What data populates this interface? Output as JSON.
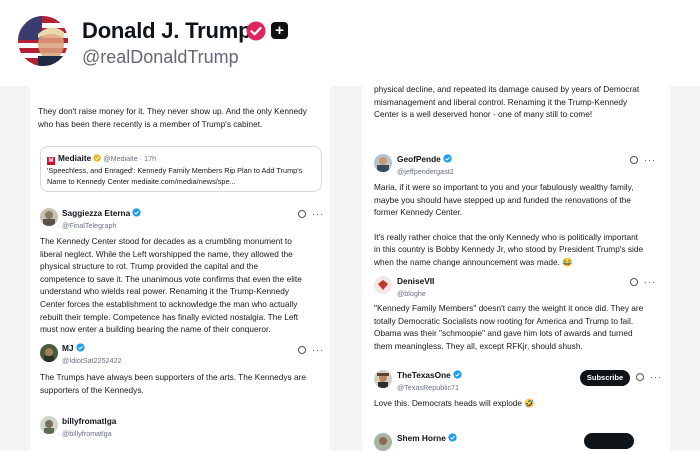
{
  "header": {
    "display_name": "Donald J. Trump",
    "handle": "@realDonaldTrump"
  },
  "left": {
    "top_text_1": "They don't raise money for it. They never show up. And the only Kennedy",
    "top_text_2": "who has been there recently is a member of Trump's cabinet.",
    "quote": {
      "source": "Mediaite",
      "handle_time": "@Mediaite · 17h",
      "line1": "'Speechless, and Enraged': Kennedy Family Members Rip Plan to Add Trump's",
      "line2": "Name to Kennedy Center  mediaite.com/media/news/spe..."
    },
    "tweets": [
      {
        "name": "Saggiezza Eterna",
        "handle": "@FinalTelegraph",
        "lines": [
          "The Kennedy Center stood for decades as a crumbling monument to",
          "liberal neglect. While the Left worshipped the name, they allowed the",
          "physical structure to rot. Trump provided the capital and the",
          "competence to save it. The unanimous vote confirms that even the elite",
          "understand who wields real power. Renaming it the Trump-Kennedy",
          "Center forces the establishment to acknowledge the man who actually",
          "rebuilt their temple. Competence has finally evicted nostalgia. The Left",
          "must now enter a building bearing the name of their conqueror."
        ]
      },
      {
        "name": "MJ",
        "handle": "@IdiotSat2252422",
        "lines": [
          "The Trumps have always been supporters of the arts. The Kennedys are",
          "supporters of the Kennedys."
        ]
      },
      {
        "name": "billyfromatlga",
        "handle": "@billyfromatlga",
        "lines": []
      }
    ]
  },
  "right": {
    "top_text_0": "physical decline, and repeated its damage caused by years of Democrat",
    "top_text_1": "mismanagement and liberal control.  Renaming it the Trump-Kennedy",
    "top_text_2": "Center is a well deserved honor - one of many still to come!",
    "tweets": [
      {
        "name": "GeofPende",
        "handle": "@jeffpendergast2",
        "lines": [
          "Maria, if it were so important to you and your fabulously wealthy family,",
          "maybe you should have stepped up and funded the renovations of the",
          "former Kennedy Center.",
          "",
          "It's really rather choice that the only Kennedy who is politically important",
          "in this country is Bobby Kennedy Jr, who stood by President Trump's side",
          "when the name change announcement was made. 😂"
        ]
      },
      {
        "name": "DeniseVII",
        "handle": "@bloghe",
        "lines": [
          "\"Kennedy Family Members\" doesn't carry the weight it once did. They are",
          "totally Democratic Socialists now rooting for America and Trump to fail.",
          "Obama was their \"schmoopie\" and gave him lots of awards and turned",
          "them meaningless.  They all, except RFKjr, should shush."
        ]
      },
      {
        "name": "TheTexasOne",
        "handle": "@TexasRepublic71",
        "subscribe": "Subscribe",
        "lines": [
          "Love this. Democrats heads will explode 🤣"
        ]
      },
      {
        "name": "Shem Horne",
        "handle": "",
        "lines": []
      }
    ]
  },
  "icons": {
    "more": "···"
  },
  "colors": {
    "verified": "#1d9bf0",
    "gold": "#e2b719",
    "badge_pink": "#e0245e"
  }
}
